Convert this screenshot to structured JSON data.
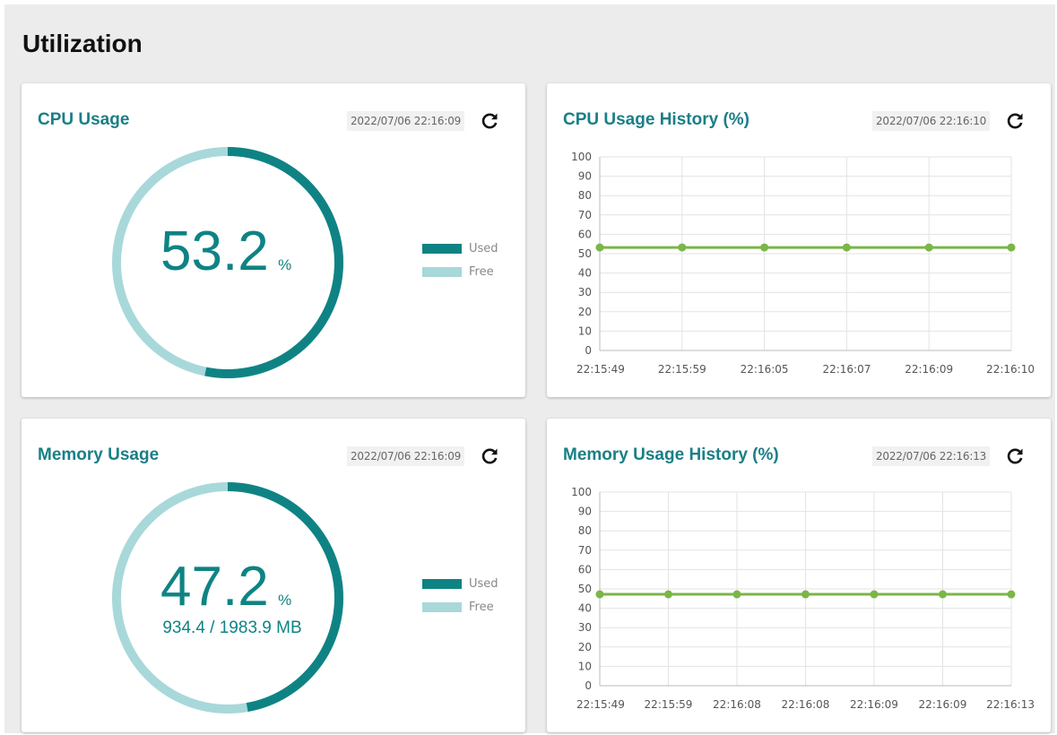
{
  "page": {
    "title": "Utilization"
  },
  "colors": {
    "used": "#0f8384",
    "free": "#a8d8da",
    "line": "#7ab648",
    "title": "#1a7f86"
  },
  "legend": {
    "used": "Used",
    "free": "Free"
  },
  "cpu": {
    "title": "CPU Usage",
    "timestamp": "2022/07/06 22:16:09",
    "value": "53.2",
    "unit": "%",
    "used_fraction": 0.532
  },
  "memory": {
    "title": "Memory Usage",
    "timestamp": "2022/07/06 22:16:09",
    "value": "47.2",
    "unit": "%",
    "detail": "934.4 / 1983.9 MB",
    "used_fraction": 0.472
  },
  "cpu_history": {
    "title": "CPU Usage History (%)",
    "timestamp": "2022/07/06 22:16:10"
  },
  "memory_history": {
    "title": "Memory Usage History (%)",
    "timestamp": "2022/07/06 22:16:13"
  },
  "chart_data": [
    {
      "type": "line",
      "title": "CPU Usage History (%)",
      "x": [
        "22:15:49",
        "22:15:59",
        "22:16:05",
        "22:16:07",
        "22:16:09",
        "22:16:10"
      ],
      "series": [
        {
          "values": [
            53.2,
            53.2,
            53.2,
            53.2,
            53.2,
            53.2
          ]
        }
      ],
      "ylim": [
        0,
        100
      ],
      "yticks": [
        0,
        10,
        20,
        30,
        40,
        50,
        60,
        70,
        80,
        90,
        100
      ],
      "grid": true
    },
    {
      "type": "line",
      "title": "Memory Usage History (%)",
      "x": [
        "22:15:49",
        "22:15:59",
        "22:16:08",
        "22:16:08",
        "22:16:09",
        "22:16:09",
        "22:16:13"
      ],
      "series": [
        {
          "values": [
            47.2,
            47.2,
            47.2,
            47.2,
            47.2,
            47.2,
            47.2
          ]
        }
      ],
      "ylim": [
        0,
        100
      ],
      "yticks": [
        0,
        10,
        20,
        30,
        40,
        50,
        60,
        70,
        80,
        90,
        100
      ],
      "grid": true
    }
  ]
}
